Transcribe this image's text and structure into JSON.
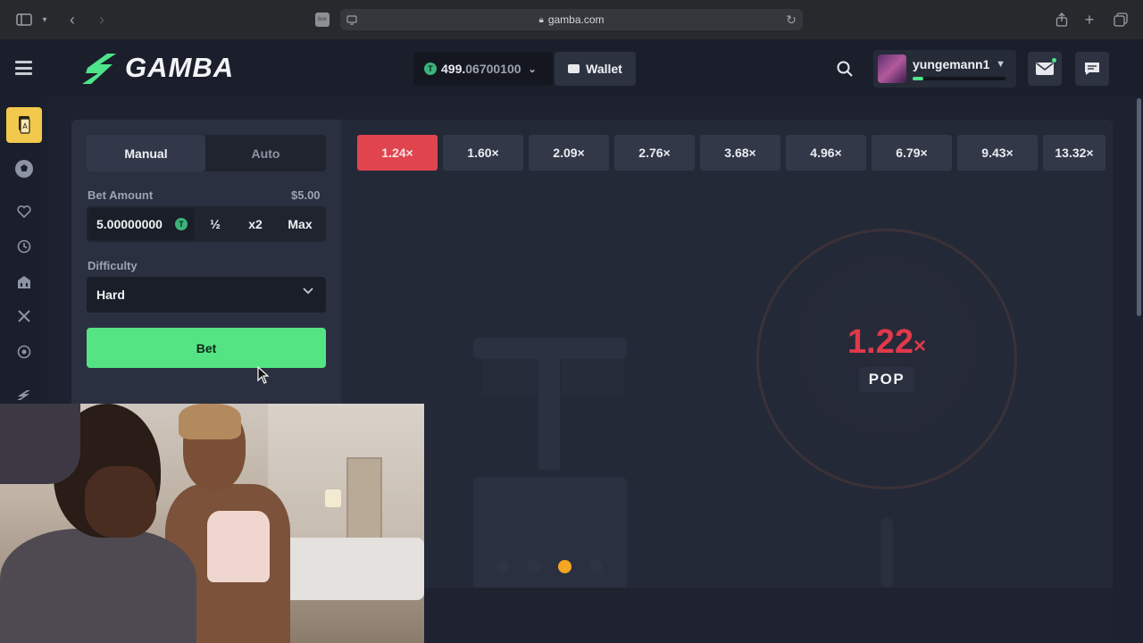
{
  "browser": {
    "url": "gamba.com",
    "favicon_text": "box"
  },
  "header": {
    "logo_text": "GAMBA",
    "balance_main": "499.",
    "balance_dim": "06700100",
    "coin_symbol": "T",
    "wallet_label": "Wallet",
    "username": "yungemann1",
    "xp_progress": 0.12
  },
  "controls": {
    "tab_manual": "Manual",
    "tab_auto": "Auto",
    "bet_amount_label": "Bet Amount",
    "bet_amount_usd": "$5.00",
    "bet_value": "5.00000000",
    "half_label": "½",
    "double_label": "x2",
    "max_label": "Max",
    "difficulty_label": "Difficulty",
    "difficulty_value": "Hard",
    "bet_button": "Bet"
  },
  "multipliers": [
    "1.24×",
    "1.60×",
    "2.09×",
    "2.76×",
    "3.68×",
    "4.96×",
    "6.79×",
    "9.43×",
    "13.32×"
  ],
  "multiplier_current_index": 0,
  "game": {
    "multiplier_value": "1.22",
    "multiplier_suffix": "×",
    "state_label": "POP",
    "active_dot_index": 2
  },
  "colors": {
    "accent_green": "#54e484",
    "loss_red": "#e0454f",
    "active_gold": "#f2c94c",
    "progress_orange": "#f5a623"
  },
  "icons": {
    "sidebar": [
      "casino-cards-icon",
      "sports-ball-icon",
      "heart-icon",
      "history-icon",
      "building-icon",
      "crossed-swords-icon",
      "target-icon",
      "gamba-mini-logo-icon"
    ],
    "header": [
      "menu-icon",
      "search-icon",
      "mail-icon",
      "chat-icon"
    ]
  }
}
